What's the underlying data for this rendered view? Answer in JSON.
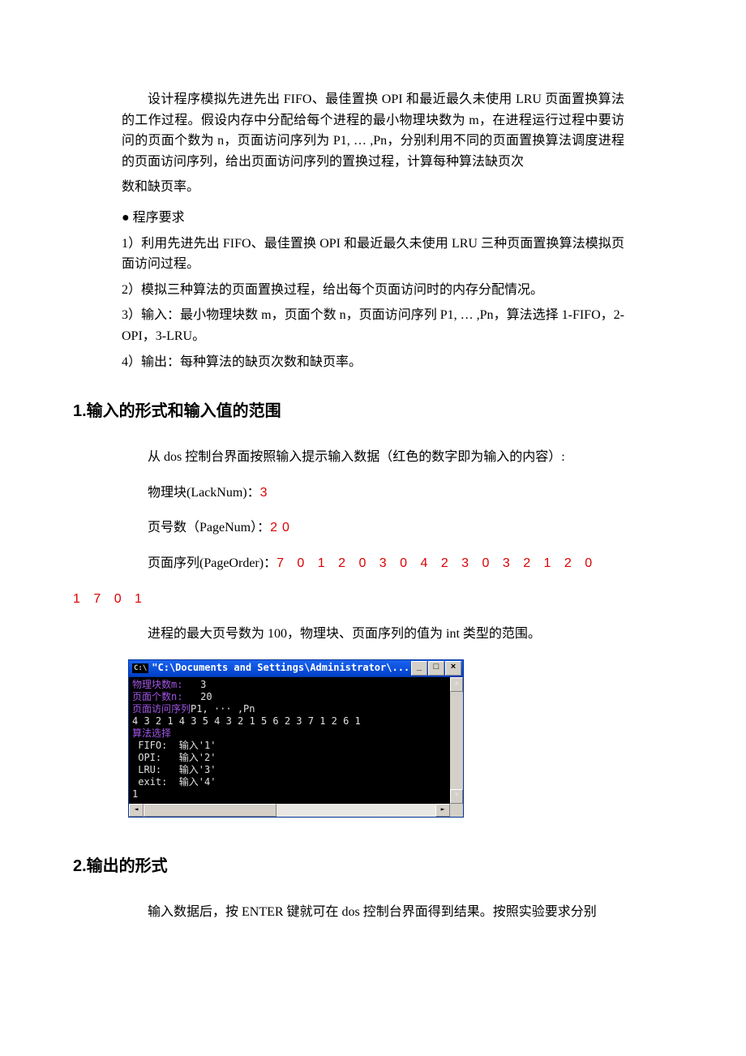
{
  "intro": {
    "p1": "设计程序模拟先进先出 FIFO、最佳置换 OPI 和最近最久未使用 LRU 页面置换算法的工作过程。假设内存中分配给每个进程的最小物理块数为 m，在进程运行过程中要访问的页面个数为 n，页面访问序列为 P1, … ,Pn，分别利用不同的页面置换算法调度进程的页面访问序列，给出页面访问序列的置换过程，计算每种算法缺页次",
    "p1b": "数和缺页率。",
    "bullet": "● 程序要求",
    "r1": "1）利用先进先出 FIFO、最佳置换 OPI 和最近最久未使用 LRU 三种页面置换算法模拟页面访问过程。",
    "r2": "2）模拟三种算法的页面置换过程，给出每个页面访问时的内存分配情况。",
    "r3": "3）输入：最小物理块数 m，页面个数 n，页面访问序列 P1, … ,Pn，算法选择 1-FIFO，2-OPI，3-LRU。",
    "r4": "4）输出：每种算法的缺页次数和缺页率。"
  },
  "section1": {
    "heading": "1.输入的形式和输入值的范围",
    "l1": "从 dos 控制台界面按照输入提示输入数据（红色的数字即为输入的内容）:",
    "l2a": "物理块(LackNum)：",
    "l2b": "3",
    "l3a": "页号数（PageNum）：",
    "l3b": "20",
    "l4a": "页面序列(PageOrder)：",
    "l4b": "7 0 1 2 0 3 0 4 2 3 0 3 2 1 2 0",
    "l4c": "1 7 0 1",
    "l5a": "进程的最大页号数为 ",
    "l5b": "100",
    "l5c": "，物理块、页面序列的值为 int 类型的范围。"
  },
  "console": {
    "icon": "C:\\",
    "title": "\"C:\\Documents and Settings\\Administrator\\...",
    "lines": {
      "a_label": "物理块数m:",
      "a_val": "   3",
      "b_label": "页面个数n:",
      "b_val": "   20",
      "c_label": "页面访问序列",
      "c_val": "P1, ··· ,Pn",
      "d": "4 3 2 1 4 3 5 4 3 2 1 5 6 2 3 7 1 2 6 1",
      "e": "算法选择",
      "f": " FIFO:  输入'1'",
      "g": " OPI:   输入'2'",
      "h": " LRU:   输入'3'",
      "i": " exit:  输入'4'",
      "j": "1"
    }
  },
  "section2": {
    "heading": "2.输出的形式",
    "l1": "输入数据后，按 ENTER 键就可在 dos 控制台界面得到结果。按照实验要求分别"
  }
}
